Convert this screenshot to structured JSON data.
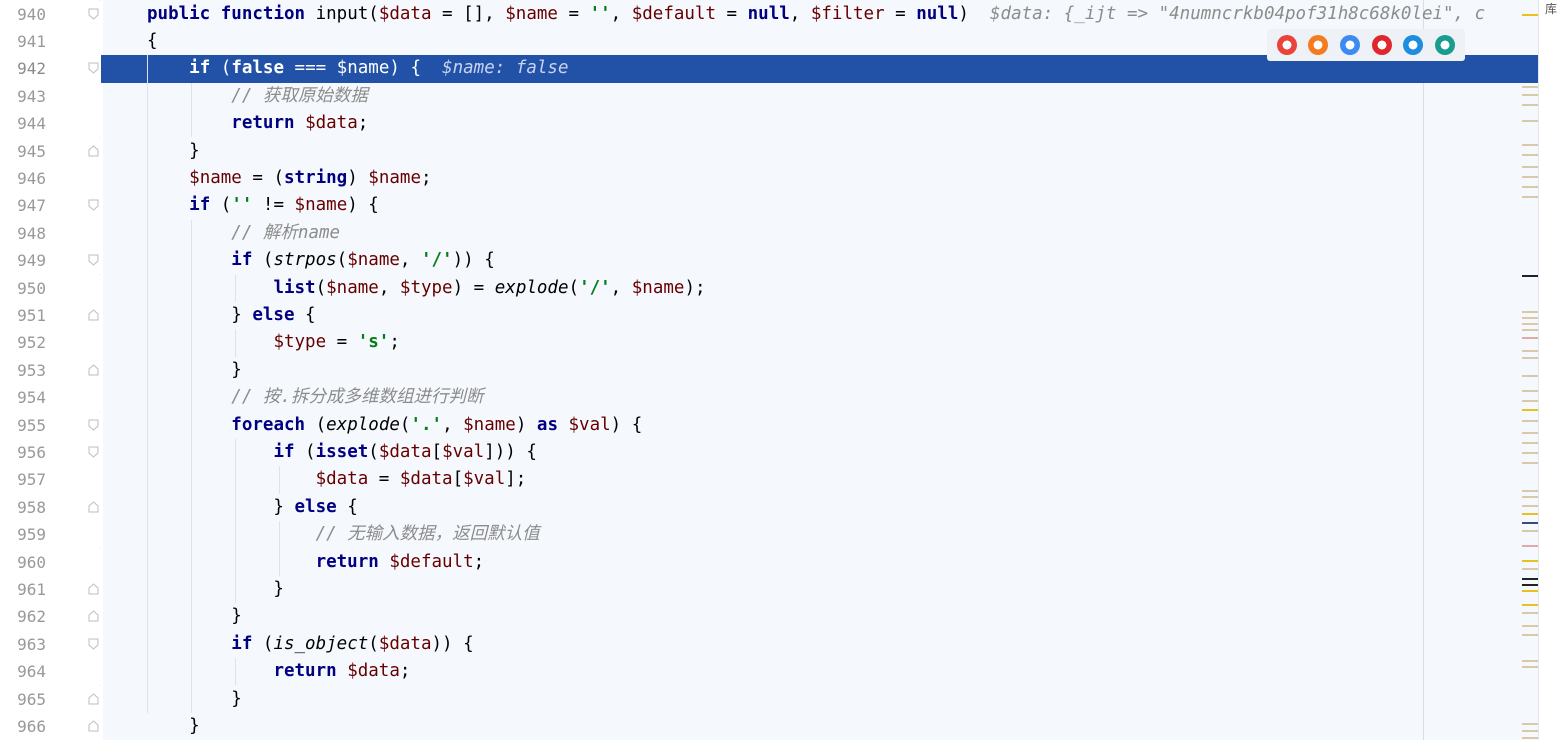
{
  "editor": {
    "inline_hint_941": "$data: {_ijt => \"4numncrkb04pof31h8c68k0lei\", c",
    "selected_line": 942,
    "lines": [
      {
        "n": "940",
        "tokens": [
          [
            "kw",
            "public "
          ],
          [
            "kw",
            "function "
          ],
          [
            "plain",
            "input("
          ],
          [
            "var",
            "$data"
          ],
          [
            "plain",
            " = [], "
          ],
          [
            "var",
            "$name"
          ],
          [
            "plain",
            " = "
          ],
          [
            "str",
            "''"
          ],
          [
            "plain",
            ", "
          ],
          [
            "var",
            "$default"
          ],
          [
            "plain",
            " = "
          ],
          [
            "kw",
            "null"
          ],
          [
            "plain",
            ", "
          ],
          [
            "var",
            "$filter"
          ],
          [
            "plain",
            " = "
          ],
          [
            "kw",
            "null"
          ],
          [
            "plain",
            ")"
          ]
        ]
      },
      {
        "n": "941",
        "tokens": [
          [
            "plain",
            "{"
          ]
        ]
      },
      {
        "n": "942",
        "tokens": [
          [
            "plain",
            "    "
          ],
          [
            "kw",
            "if "
          ],
          [
            "plain",
            "("
          ],
          [
            "kw",
            "false"
          ],
          [
            "plain",
            " === "
          ],
          [
            "var",
            "$name"
          ],
          [
            "plain",
            ") {  "
          ],
          [
            "hint",
            "$name: false"
          ]
        ]
      },
      {
        "n": "943",
        "tokens": [
          [
            "plain",
            "        "
          ],
          [
            "cmt",
            "// 获取原始数据"
          ]
        ]
      },
      {
        "n": "944",
        "tokens": [
          [
            "plain",
            "        "
          ],
          [
            "kw",
            "return "
          ],
          [
            "var",
            "$data"
          ],
          [
            "plain",
            ";"
          ]
        ]
      },
      {
        "n": "945",
        "tokens": [
          [
            "plain",
            "    }"
          ]
        ]
      },
      {
        "n": "946",
        "tokens": [
          [
            "plain",
            "    "
          ],
          [
            "var",
            "$name"
          ],
          [
            "plain",
            " = ("
          ],
          [
            "kw",
            "string"
          ],
          [
            "plain",
            ") "
          ],
          [
            "var",
            "$name"
          ],
          [
            "plain",
            ";"
          ]
        ]
      },
      {
        "n": "947",
        "tokens": [
          [
            "plain",
            "    "
          ],
          [
            "kw",
            "if "
          ],
          [
            "plain",
            "("
          ],
          [
            "str",
            "''"
          ],
          [
            "plain",
            " != "
          ],
          [
            "var",
            "$name"
          ],
          [
            "plain",
            ") {"
          ]
        ]
      },
      {
        "n": "948",
        "tokens": [
          [
            "plain",
            "        "
          ],
          [
            "cmt",
            "// 解析name"
          ]
        ]
      },
      {
        "n": "949",
        "tokens": [
          [
            "plain",
            "        "
          ],
          [
            "kw",
            "if "
          ],
          [
            "plain",
            "("
          ],
          [
            "fn",
            "strpos"
          ],
          [
            "plain",
            "("
          ],
          [
            "var",
            "$name"
          ],
          [
            "plain",
            ", "
          ],
          [
            "str",
            "'/'"
          ],
          [
            "plain",
            ")) {"
          ]
        ]
      },
      {
        "n": "950",
        "tokens": [
          [
            "plain",
            "            "
          ],
          [
            "kw",
            "list"
          ],
          [
            "plain",
            "("
          ],
          [
            "var",
            "$name"
          ],
          [
            "plain",
            ", "
          ],
          [
            "var",
            "$type"
          ],
          [
            "plain",
            ") = "
          ],
          [
            "fn",
            "explode"
          ],
          [
            "plain",
            "("
          ],
          [
            "str",
            "'/'"
          ],
          [
            "plain",
            ", "
          ],
          [
            "var",
            "$name"
          ],
          [
            "plain",
            ");"
          ]
        ]
      },
      {
        "n": "951",
        "tokens": [
          [
            "plain",
            "        } "
          ],
          [
            "kw",
            "else "
          ],
          [
            "plain",
            "{"
          ]
        ]
      },
      {
        "n": "952",
        "tokens": [
          [
            "plain",
            "            "
          ],
          [
            "var",
            "$type"
          ],
          [
            "plain",
            " = "
          ],
          [
            "str",
            "'s'"
          ],
          [
            "plain",
            ";"
          ]
        ]
      },
      {
        "n": "953",
        "tokens": [
          [
            "plain",
            "        }"
          ]
        ]
      },
      {
        "n": "954",
        "tokens": [
          [
            "plain",
            "        "
          ],
          [
            "cmt",
            "// 按.拆分成多维数组进行判断"
          ]
        ]
      },
      {
        "n": "955",
        "tokens": [
          [
            "plain",
            "        "
          ],
          [
            "kw",
            "foreach "
          ],
          [
            "plain",
            "("
          ],
          [
            "fn",
            "explode"
          ],
          [
            "plain",
            "("
          ],
          [
            "str",
            "'.'"
          ],
          [
            "plain",
            ", "
          ],
          [
            "var",
            "$name"
          ],
          [
            "plain",
            ") "
          ],
          [
            "kw",
            "as "
          ],
          [
            "var",
            "$val"
          ],
          [
            "plain",
            ") {"
          ]
        ]
      },
      {
        "n": "956",
        "tokens": [
          [
            "plain",
            "            "
          ],
          [
            "kw",
            "if "
          ],
          [
            "plain",
            "("
          ],
          [
            "kw",
            "isset"
          ],
          [
            "plain",
            "("
          ],
          [
            "var",
            "$data"
          ],
          [
            "plain",
            "["
          ],
          [
            "var",
            "$val"
          ],
          [
            "plain",
            "])) {"
          ]
        ]
      },
      {
        "n": "957",
        "tokens": [
          [
            "plain",
            "                "
          ],
          [
            "var",
            "$data"
          ],
          [
            "plain",
            " = "
          ],
          [
            "var",
            "$data"
          ],
          [
            "plain",
            "["
          ],
          [
            "var",
            "$val"
          ],
          [
            "plain",
            "];"
          ]
        ]
      },
      {
        "n": "958",
        "tokens": [
          [
            "plain",
            "            } "
          ],
          [
            "kw",
            "else "
          ],
          [
            "plain",
            "{"
          ]
        ]
      },
      {
        "n": "959",
        "tokens": [
          [
            "plain",
            "                "
          ],
          [
            "cmt",
            "// 无输入数据，返回默认值"
          ]
        ]
      },
      {
        "n": "960",
        "tokens": [
          [
            "plain",
            "                "
          ],
          [
            "kw",
            "return "
          ],
          [
            "var",
            "$default"
          ],
          [
            "plain",
            ";"
          ]
        ]
      },
      {
        "n": "961",
        "tokens": [
          [
            "plain",
            "            }"
          ]
        ]
      },
      {
        "n": "962",
        "tokens": [
          [
            "plain",
            "        }"
          ]
        ]
      },
      {
        "n": "963",
        "tokens": [
          [
            "plain",
            "        "
          ],
          [
            "kw",
            "if "
          ],
          [
            "plain",
            "("
          ],
          [
            "fn",
            "is_object"
          ],
          [
            "plain",
            "("
          ],
          [
            "var",
            "$data"
          ],
          [
            "plain",
            ")) {"
          ]
        ]
      },
      {
        "n": "964",
        "tokens": [
          [
            "plain",
            "            "
          ],
          [
            "kw",
            "return "
          ],
          [
            "var",
            "$data"
          ],
          [
            "plain",
            ";"
          ]
        ]
      },
      {
        "n": "965",
        "tokens": [
          [
            "plain",
            "        }"
          ]
        ]
      },
      {
        "n": "966",
        "tokens": [
          [
            "plain",
            "    }"
          ]
        ]
      }
    ]
  },
  "browser_bar": {
    "icons": [
      {
        "name": "chrome-icon",
        "color": "#e9433b"
      },
      {
        "name": "firefox-icon",
        "color": "#f47b20"
      },
      {
        "name": "safari-icon",
        "color": "#3d8bf2"
      },
      {
        "name": "opera-icon",
        "color": "#e0262f"
      },
      {
        "name": "ie-icon",
        "color": "#1c8de0"
      },
      {
        "name": "edge-icon",
        "color": "#1a9d8f"
      }
    ]
  },
  "side_panel_char": "库",
  "colors": {
    "selection": "#2252a8",
    "keyword": "#000080",
    "variable": "#660000",
    "string": "#067d17",
    "comment": "#8c8c8c"
  }
}
